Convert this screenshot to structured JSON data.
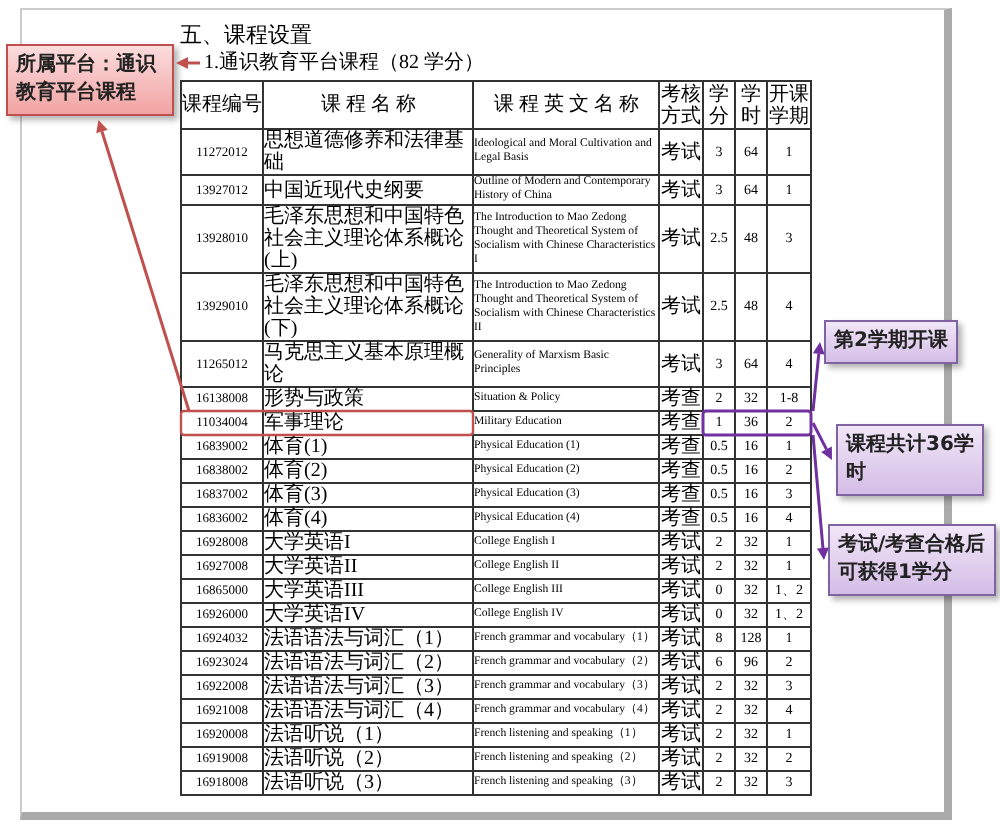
{
  "heading": "五、课程设置",
  "subheading": "1.通识教育平台课程（82 学分）",
  "table": {
    "columns": [
      "课程编号",
      "课 程 名 称",
      "课 程 英 文 名 称",
      "考核方式",
      "学分",
      "学时",
      "开课学期"
    ],
    "rows": [
      {
        "highlighted": false,
        "cells": [
          "11272012",
          "思想道德修养和法律基础",
          "Ideological and Moral Cultivation and Legal Basis",
          "考试",
          "3",
          "64",
          "1"
        ]
      },
      {
        "highlighted": false,
        "cells": [
          "13927012",
          "中国近现代史纲要",
          "Outline of Modern and Contemporary History of China",
          "考试",
          "3",
          "64",
          "1"
        ]
      },
      {
        "highlighted": false,
        "cells": [
          "13928010",
          "毛泽东思想和中国特色社会主义理论体系概论(上)",
          "The Introduction to Mao Zedong Thought and Theoretical System of Socialism with Chinese Characteristics I",
          "考试",
          "2.5",
          "48",
          "3"
        ]
      },
      {
        "highlighted": false,
        "cells": [
          "13929010",
          "毛泽东思想和中国特色社会主义理论体系概论(下)",
          "The Introduction to Mao Zedong Thought and Theoretical System of Socialism with Chinese Characteristics II",
          "考试",
          "2.5",
          "48",
          "4"
        ]
      },
      {
        "highlighted": false,
        "cells": [
          "11265012",
          "马克思主义基本原理概论",
          "Generality of Marxism Basic Principles",
          "考试",
          "3",
          "64",
          "4"
        ]
      },
      {
        "highlighted": false,
        "cells": [
          "16138008",
          "形势与政策",
          "Situation & Policy",
          "考查",
          "2",
          "32",
          "1-8"
        ]
      },
      {
        "highlighted": true,
        "cells": [
          "11034004",
          "军事理论",
          "Military Education",
          "考查",
          "1",
          "36",
          "2"
        ]
      },
      {
        "highlighted": false,
        "cells": [
          "16839002",
          "体育(1)",
          "Physical Education (1)",
          "考查",
          "0.5",
          "16",
          "1"
        ]
      },
      {
        "highlighted": false,
        "cells": [
          "16838002",
          "体育(2)",
          "Physical Education (2)",
          "考查",
          "0.5",
          "16",
          "2"
        ]
      },
      {
        "highlighted": false,
        "cells": [
          "16837002",
          "体育(3)",
          "Physical Education (3)",
          "考查",
          "0.5",
          "16",
          "3"
        ]
      },
      {
        "highlighted": false,
        "cells": [
          "16836002",
          "体育(4)",
          "Physical Education (4)",
          "考查",
          "0.5",
          "16",
          "4"
        ]
      },
      {
        "highlighted": false,
        "cells": [
          "16928008",
          "大学英语I",
          "College English I",
          "考试",
          "2",
          "32",
          "1"
        ]
      },
      {
        "highlighted": false,
        "cells": [
          "16927008",
          "大学英语II",
          "College English II",
          "考试",
          "2",
          "32",
          "1"
        ]
      },
      {
        "highlighted": false,
        "cells": [
          "16865000",
          "大学英语III",
          "College English III",
          "考试",
          "0",
          "32",
          "1、2"
        ]
      },
      {
        "highlighted": false,
        "cells": [
          "16926000",
          "大学英语IV",
          "College English IV",
          "考试",
          "0",
          "32",
          "1、2"
        ]
      },
      {
        "highlighted": false,
        "cells": [
          "16924032",
          "法语语法与词汇（1）",
          "French grammar and vocabulary（1）",
          "考试",
          "8",
          "128",
          "1"
        ]
      },
      {
        "highlighted": false,
        "cells": [
          "16923024",
          "法语语法与词汇（2）",
          "French grammar and vocabulary（2）",
          "考试",
          "6",
          "96",
          "2"
        ]
      },
      {
        "highlighted": false,
        "cells": [
          "16922008",
          "法语语法与词汇（3）",
          "French grammar and vocabulary（3）",
          "考试",
          "2",
          "32",
          "3"
        ]
      },
      {
        "highlighted": false,
        "cells": [
          "16921008",
          "法语语法与词汇（4）",
          "French grammar and vocabulary（4）",
          "考试",
          "2",
          "32",
          "4"
        ]
      },
      {
        "highlighted": false,
        "cells": [
          "16920008",
          "法语听说（1）",
          "French listening and speaking（1）",
          "考试",
          "2",
          "32",
          "1"
        ]
      },
      {
        "highlighted": false,
        "cells": [
          "16919008",
          "法语听说（2）",
          "French listening and speaking（2）",
          "考试",
          "2",
          "32",
          "2"
        ]
      },
      {
        "highlighted": false,
        "cells": [
          "16918008",
          "法语听说（3）",
          "French listening and speaking（3）",
          "考试",
          "2",
          "32",
          "3"
        ]
      }
    ]
  },
  "callouts": [
    {
      "kind": "platform",
      "text": "所属平台：通识教育平台课程"
    },
    {
      "kind": "term",
      "text": "第2学期开课"
    },
    {
      "kind": "hours",
      "text": "课程共计36学时"
    },
    {
      "kind": "credits",
      "text": "考试/考查合格后可获得1学分"
    }
  ]
}
